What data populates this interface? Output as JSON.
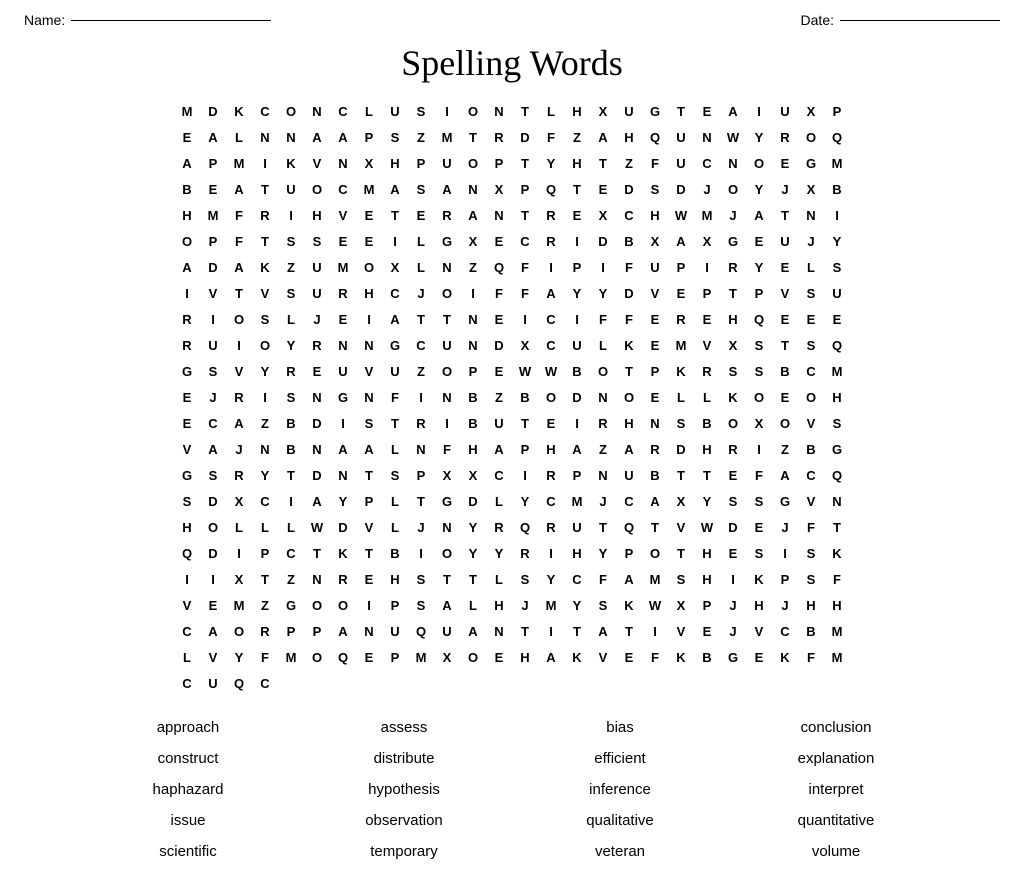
{
  "header": {
    "name_label": "Name:",
    "date_label": "Date:"
  },
  "title": "Spelling Words",
  "grid_rows": [
    [
      "M",
      "D",
      "K",
      "C",
      "O",
      "N",
      "C",
      "L",
      "U",
      "S",
      "I",
      "O",
      "N",
      "T",
      "L",
      "H",
      "X",
      "U",
      "G",
      "T",
      "E",
      "A",
      "I",
      "U"
    ],
    [
      "X",
      "P",
      "E",
      "A",
      "L",
      "N",
      "N",
      "A",
      "A",
      "P",
      "S",
      "Z",
      "M",
      "T",
      "R",
      "D",
      "F",
      "Z",
      "A",
      "H",
      "Q",
      "U",
      "N",
      "W"
    ],
    [
      "Y",
      "R",
      "O",
      "Q",
      "A",
      "P",
      "M",
      "I",
      "K",
      "V",
      "N",
      "X",
      "H",
      "P",
      "U",
      "O",
      "P",
      "T",
      "Y",
      "H",
      "T",
      "Z",
      "F",
      "U"
    ],
    [
      "C",
      "N",
      "O",
      "E",
      "G",
      "M",
      "B",
      "E",
      "A",
      "T",
      "U",
      "O",
      "C",
      "M",
      "A",
      "S",
      "A",
      "N",
      "X",
      "P",
      "Q",
      "T",
      "E",
      "D"
    ],
    [
      "S",
      "D",
      "J",
      "O",
      "Y",
      "J",
      "X",
      "B",
      "H",
      "M",
      "F",
      "R",
      "I",
      "H",
      "V",
      "E",
      "T",
      "E",
      "R",
      "A",
      "N",
      "T",
      "R",
      "E"
    ],
    [
      "X",
      "C",
      "H",
      "W",
      "M",
      "J",
      "A",
      "T",
      "N",
      "I",
      "O",
      "P",
      "F",
      "T",
      "S",
      "S",
      "E",
      "E",
      "I",
      "L",
      "G",
      "X",
      "E",
      "C"
    ],
    [
      "R",
      "I",
      "D",
      "B",
      "X",
      "A",
      "X",
      "G",
      "E",
      "U",
      "J",
      "Y",
      "A",
      "D",
      "A",
      "K",
      "Z",
      "U",
      "M",
      "O",
      "X",
      "L",
      "N",
      "Z"
    ],
    [
      "Q",
      "F",
      "I",
      "P",
      "I",
      "F",
      "U",
      "P",
      "I",
      "R",
      "Y",
      "E",
      "L",
      "S",
      "I",
      "V",
      "T",
      "V",
      "S",
      "U",
      "R",
      "H",
      "C",
      "J"
    ],
    [
      "O",
      "I",
      "F",
      "F",
      "A",
      "Y",
      "Y",
      "D",
      "V",
      "E",
      "P",
      "T",
      "P",
      "V",
      "S",
      "U",
      "R",
      "I",
      "O",
      "S",
      "L",
      "J",
      "E",
      "I"
    ],
    [
      "A",
      "T",
      "T",
      "N",
      "E",
      "I",
      "C",
      "I",
      "F",
      "F",
      "E",
      "R",
      "E",
      "H",
      "Q",
      "E",
      "E",
      "E",
      "R",
      "U",
      "I",
      "O",
      "Y",
      "R"
    ],
    [
      "N",
      "N",
      "G",
      "C",
      "U",
      "N",
      "D",
      "X",
      "C",
      "U",
      "L",
      "K",
      "E",
      "M",
      "V",
      "X",
      "S",
      "T",
      "S",
      "Q",
      "G",
      "S",
      "V",
      "Y"
    ],
    [
      "R",
      "E",
      "U",
      "V",
      "U",
      "Z",
      "O",
      "P",
      "E",
      "W",
      "W",
      "B",
      "O",
      "T",
      "P",
      "K",
      "R",
      "S",
      "S",
      "B",
      "C",
      "M",
      "E",
      "J"
    ],
    [
      "R",
      "I",
      "S",
      "N",
      "G",
      "N",
      "F",
      "I",
      "N",
      "B",
      "Z",
      "B",
      "O",
      "D",
      "N",
      "O",
      "E",
      "L",
      "L",
      "K",
      "O",
      "E",
      "O",
      "H"
    ],
    [
      "E",
      "C",
      "A",
      "Z",
      "B",
      "D",
      "I",
      "S",
      "T",
      "R",
      "I",
      "B",
      "U",
      "T",
      "E",
      "I",
      "R",
      "H",
      "N",
      "S",
      "B",
      "O",
      "X",
      "O"
    ],
    [
      "V",
      "S",
      "V",
      "A",
      "J",
      "N",
      "B",
      "N",
      "A",
      "A",
      "L",
      "N",
      "F",
      "H",
      "A",
      "P",
      "H",
      "A",
      "Z",
      "A",
      "R",
      "D",
      "H",
      "R"
    ],
    [
      "I",
      "Z",
      "B",
      "G",
      "G",
      "S",
      "R",
      "Y",
      "T",
      "D",
      "N",
      "T",
      "S",
      "P",
      "X",
      "X",
      "C",
      "I",
      "R",
      "P",
      "N",
      "U",
      "B",
      "T"
    ],
    [
      "T",
      "E",
      "F",
      "A",
      "C",
      "Q",
      "S",
      "D",
      "X",
      "C",
      "I",
      "A",
      "Y",
      "P",
      "L",
      "T",
      "G",
      "D",
      "L",
      "Y",
      "C",
      "M",
      "J",
      "C"
    ],
    [
      "A",
      "X",
      "Y",
      "S",
      "S",
      "G",
      "V",
      "N",
      "H",
      "O",
      "L",
      "L",
      "L",
      "W",
      "D",
      "V",
      "L",
      "J",
      "N",
      "Y",
      "R",
      "Q",
      "R",
      "U"
    ],
    [
      "T",
      "Q",
      "T",
      "V",
      "W",
      "D",
      "E",
      "J",
      "F",
      "T",
      "Q",
      "D",
      "I",
      "P",
      "C",
      "T",
      "K",
      "T",
      "B",
      "I",
      "O",
      "Y",
      "Y",
      "R"
    ],
    [
      "I",
      "H",
      "Y",
      "P",
      "O",
      "T",
      "H",
      "E",
      "S",
      "I",
      "S",
      "K",
      "I",
      "I",
      "X",
      "T",
      "Z",
      "N",
      "R",
      "E",
      "H",
      "S",
      "T",
      "T"
    ],
    [
      "L",
      "S",
      "Y",
      "C",
      "F",
      "A",
      "M",
      "S",
      "H",
      "I",
      "K",
      "P",
      "S",
      "F",
      "V",
      "E",
      "M",
      "Z",
      "G",
      "O",
      "O",
      "I",
      "P",
      "S"
    ],
    [
      "A",
      "L",
      "H",
      "J",
      "M",
      "Y",
      "S",
      "K",
      "W",
      "X",
      "P",
      "J",
      "H",
      "J",
      "H",
      "H",
      "C",
      "A",
      "O",
      "R",
      "P",
      "P",
      "A",
      "N"
    ],
    [
      "U",
      "Q",
      "U",
      "A",
      "N",
      "T",
      "I",
      "T",
      "A",
      "T",
      "I",
      "V",
      "E",
      "J",
      "V",
      "C",
      "B",
      "M",
      "L",
      "V",
      "Y",
      "F",
      "M",
      "O"
    ],
    [
      "Q",
      "E",
      "P",
      "M",
      "X",
      "O",
      "E",
      "H",
      "A",
      "K",
      "V",
      "E",
      "F",
      "K",
      "B",
      "G",
      "E",
      "K",
      "F",
      "M",
      "C",
      "U",
      "Q",
      "C"
    ]
  ],
  "word_list": {
    "col1": [
      "approach",
      "construct",
      "haphazard",
      "issue",
      "scientific"
    ],
    "col2": [
      "assess",
      "distribute",
      "hypothesis",
      "observation",
      "temporary"
    ],
    "col3": [
      "bias",
      "efficient",
      "inference",
      "qualitative",
      "veteran"
    ],
    "col4": [
      "conclusion",
      "explanation",
      "interpret",
      "quantitative",
      "volume"
    ]
  }
}
